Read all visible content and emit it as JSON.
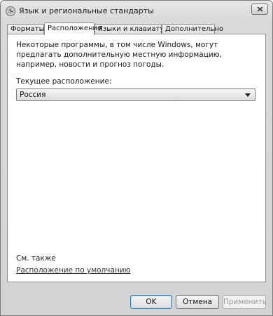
{
  "window": {
    "title": "Язык и региональные стандарты"
  },
  "tabs": [
    {
      "label": "Форматы",
      "active": false
    },
    {
      "label": "Расположение",
      "active": true
    },
    {
      "label": "Языки и клавиатуры",
      "active": false
    },
    {
      "label": "Дополнительно",
      "active": false
    }
  ],
  "panel": {
    "description": "Некоторые программы, в том числе Windows, могут предлагать дополнительную местную информацию, например, новости и прогноз погоды.",
    "location_label": "Текущее расположение:",
    "location_value": "Россия",
    "see_also": "См. также",
    "default_link": "Расположение по умолчанию"
  },
  "buttons": {
    "ok": "OK",
    "cancel": "Отмена",
    "apply": "Применить"
  },
  "icons": {
    "app": "globe-clock-icon",
    "close": "close-icon",
    "dropdown": "chevron-down-icon"
  }
}
